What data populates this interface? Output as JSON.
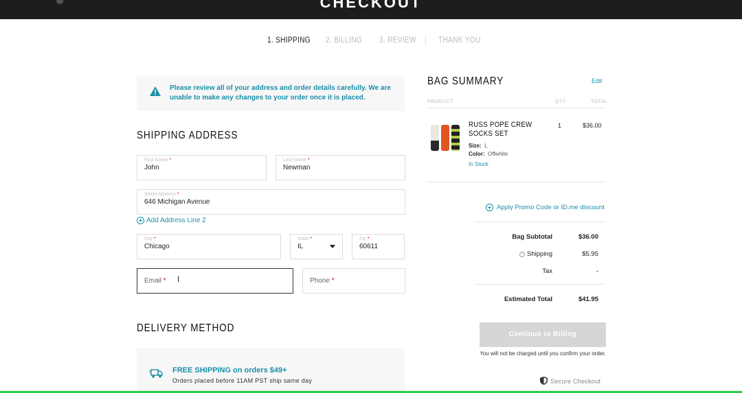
{
  "header": {
    "title": "CHECKOUT"
  },
  "steps": [
    {
      "label": "1. SHIPPING",
      "active": true
    },
    {
      "label": "2. BILLING",
      "active": false
    },
    {
      "label": "3. REVIEW",
      "active": false
    },
    {
      "label": "THANK YOU",
      "active": false
    }
  ],
  "alert": {
    "icon": "warning-icon",
    "message": "Please review all of your address and order details carefully. We are unable to make any changes to your order once it is placed."
  },
  "shipping": {
    "heading": "SHIPPING ADDRESS",
    "first_name": {
      "label": "First Name",
      "value": "John"
    },
    "last_name": {
      "label": "Last Name",
      "value": "Newman"
    },
    "street": {
      "label": "Street Address",
      "value": "646 Michigan Avenue"
    },
    "add_line_label": "Add Address Line 2",
    "city": {
      "label": "City",
      "value": "Chicago"
    },
    "state": {
      "label": "State",
      "value": "IL"
    },
    "zip": {
      "label": "Zip",
      "value": "60611"
    },
    "email": {
      "placeholder": "Email"
    },
    "phone": {
      "placeholder": "Phone"
    }
  },
  "delivery": {
    "heading": "DELIVERY METHOD",
    "promo_title": "FREE SHIPPING on orders $49+",
    "promo_sub": "Orders placed before 11AM PST ship same day",
    "icon": "truck-icon"
  },
  "summary": {
    "heading": "BAG SUMMARY",
    "edit_label": "Edit",
    "col_product": "PRODUCT",
    "col_qty": "QTY",
    "col_total": "TOTAL",
    "item": {
      "name": "RUSS POPE CREW SOCKS SET",
      "size_label": "Size:",
      "size": "L",
      "color_label": "Color:",
      "color": "Offwhite",
      "stock": "In Stock",
      "qty": "1",
      "price": "$36.00"
    },
    "promo_link": "Apply Promo Code or ID.me discount",
    "subtotal_label": "Bag Subtotal",
    "subtotal": "$36.00",
    "shipping_label": "Shipping",
    "shipping": "$5.95",
    "tax_label": "Tax",
    "tax": "-",
    "total_label": "Estimated Total",
    "total": "$41.95",
    "cta_label": "Continue to Billing",
    "note": "You will not be charged until you confirm your order.",
    "secure_label": "Secure Checkout"
  },
  "colors": {
    "accent": "#1a8fa8",
    "required": "#d0021b",
    "disabled_button": "#d6d6d6"
  }
}
